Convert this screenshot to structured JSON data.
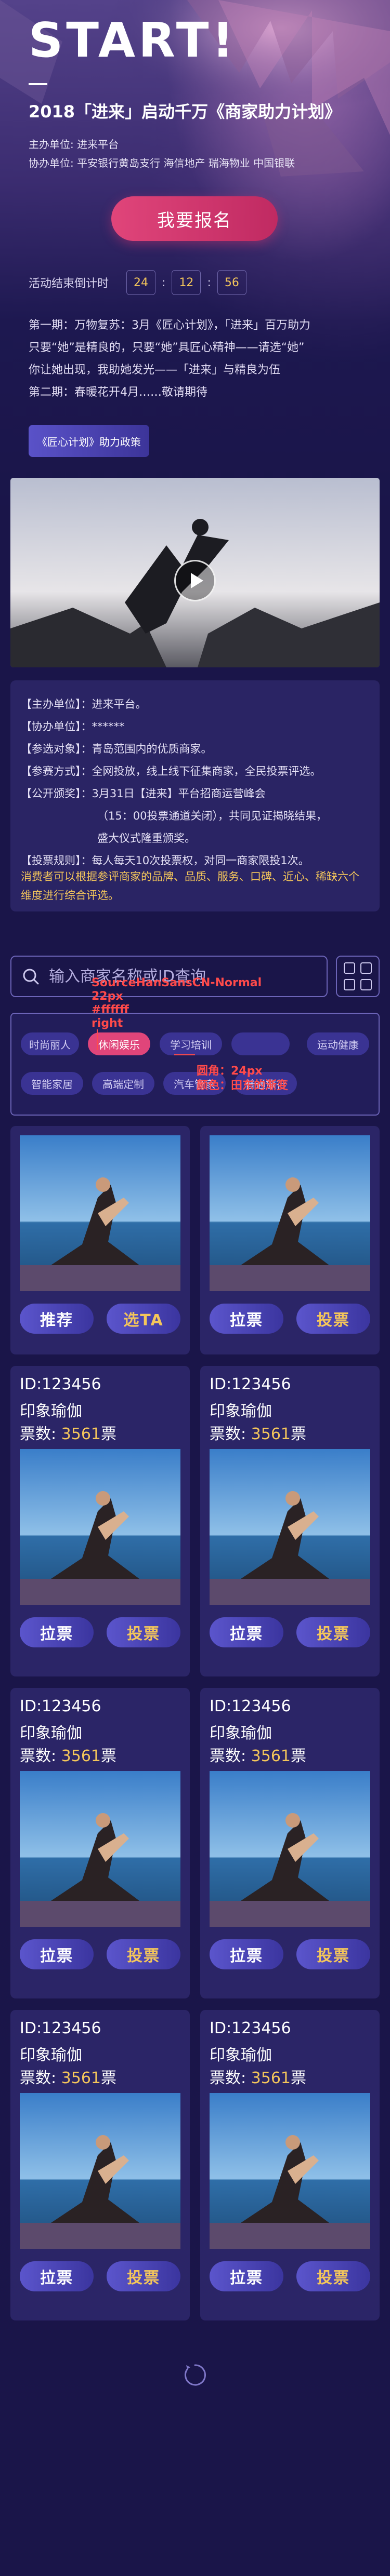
{
  "hero": {
    "logo": "START!",
    "title": "2018「进来」启动千万《商家助力计划》",
    "host": "主办单位: 进来平台",
    "co_host": "协办单位: 平安银行黄岛支行  海信地产  瑞海物业  中国银联",
    "signup_label": "我要报名"
  },
  "countdown": {
    "label": "活动结束倒计时",
    "hours": "24",
    "minutes": "12",
    "seconds": "56"
  },
  "intro": [
    "第一期：万物复苏：3月《匠心计划》，「进来」百万助力",
    "只要“她”是精良的，只要“她”具匠心精神——请选“她”",
    "你让她出现，我助她发光——「进来」与精良为伍",
    "第二期：春暖花开4月……敬请期待"
  ],
  "policy_button": "《匠心计划》助力政策",
  "info": {
    "rows": [
      {
        "k": "【主办单位】：",
        "v": "进来平台。"
      },
      {
        "k": "【协办单位】：",
        "v": "******"
      },
      {
        "k": "【参选对象】：",
        "v": "青岛范围内的优质商家。"
      },
      {
        "k": "【参赛方式】：",
        "v": "全网投放，线上线下征集商家，全民投票评选。"
      },
      {
        "k": "【公开颁奖】：",
        "v": "3月31日【进来】平台招商运营峰会"
      },
      {
        "k": "",
        "v": "（15：00投票通道关闭），共同见证揭晓结果，"
      },
      {
        "k": "",
        "v": "盛大仪式隆重颁奖。"
      },
      {
        "k": "【投票规则】：",
        "v": "每人每天10次投票权，对同一商家限投1次。"
      }
    ],
    "note": "消费者可以根据参评商家的品牌、品质、服务、口碑、近心、稀缺六个维度进行综合评选。"
  },
  "search": {
    "placeholder": "输入商家名称或ID查询"
  },
  "tags": [
    {
      "label": "时尚丽人",
      "active": false
    },
    {
      "label": "休闲娱乐",
      "active": true
    },
    {
      "label": "学习培训",
      "active": false
    },
    {
      "label": "",
      "active": false
    },
    {
      "label": "运动健康",
      "active": false
    },
    {
      "label": "智能家居",
      "active": false
    },
    {
      "label": "高端定制",
      "active": false
    },
    {
      "label": "汽车管家",
      "active": false
    },
    {
      "label": "普通旅行",
      "active": false
    }
  ],
  "annotations": {
    "font": "SourceHanSansCN-Normal",
    "size": "22px",
    "weight": "#ffffff",
    "align": "right",
    "radius_label": "圆角：24px",
    "color_label": "颜色：田东的渐变"
  },
  "cards": [
    {
      "id": "",
      "name": "",
      "votes_label": "",
      "votes": "",
      "unit": "",
      "left_btn": "推荐",
      "right_btn": "选TA"
    },
    {
      "id": "",
      "name": "",
      "votes_label": "",
      "votes": "",
      "unit": "",
      "left_btn": "拉票",
      "right_btn": "投票"
    },
    {
      "id": "ID:123456",
      "name": "印象瑜伽",
      "votes_label": "票数: ",
      "votes": "3561",
      "unit": "票",
      "left_btn": "拉票",
      "right_btn": "投票"
    },
    {
      "id": "ID:123456",
      "name": "印象瑜伽",
      "votes_label": "票数: ",
      "votes": "3561",
      "unit": "票",
      "left_btn": "拉票",
      "right_btn": "投票"
    },
    {
      "id": "ID:123456",
      "name": "印象瑜伽",
      "votes_label": "票数: ",
      "votes": "3561",
      "unit": "票",
      "left_btn": "拉票",
      "right_btn": "投票"
    },
    {
      "id": "ID:123456",
      "name": "印象瑜伽",
      "votes_label": "票数: ",
      "votes": "3561",
      "unit": "票",
      "left_btn": "拉票",
      "right_btn": "投票"
    },
    {
      "id": "ID:123456",
      "name": "印象瑜伽",
      "votes_label": "票数: ",
      "votes": "3561",
      "unit": "票",
      "left_btn": "拉票",
      "right_btn": "投票"
    },
    {
      "id": "ID:123456",
      "name": "印象瑜伽",
      "votes_label": "票数: ",
      "votes": "3561",
      "unit": "票",
      "left_btn": "拉票",
      "right_btn": "投票"
    }
  ],
  "icons": {
    "search": "search-icon",
    "grid": "grid-view-icon",
    "play": "play-icon",
    "loading": "loading-spinner-icon"
  },
  "colors": {
    "background": "#1a1549",
    "accent_pink": "#e0457a",
    "gold": "#f4c65b",
    "card": "#2b2567"
  }
}
